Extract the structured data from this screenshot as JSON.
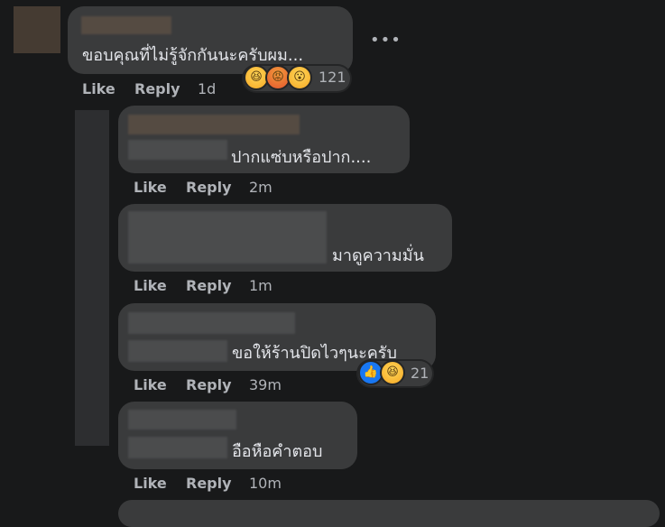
{
  "comments": [
    {
      "text": "ขอบคุณที่ไม่รู้จักกันนะครับผม...",
      "like": "Like",
      "reply": "Reply",
      "time": "1d",
      "reactions": [
        "haha",
        "angry",
        "wow"
      ],
      "reaction_count": "121"
    },
    {
      "text": "ปากแซ่บหรือปาก....",
      "like": "Like",
      "reply": "Reply",
      "time": "2m"
    },
    {
      "text": "มาดูความมั่น",
      "like": "Like",
      "reply": "Reply",
      "time": "1m"
    },
    {
      "text": "ขอให้ร้านปิดไวๆนะครับ",
      "like": "Like",
      "reply": "Reply",
      "time": "39m",
      "reactions": [
        "like",
        "haha"
      ],
      "reaction_count": "21"
    },
    {
      "text": "อือหือคำตอบ",
      "like": "Like",
      "reply": "Reply",
      "time": "10m"
    }
  ],
  "more_options": "•••"
}
